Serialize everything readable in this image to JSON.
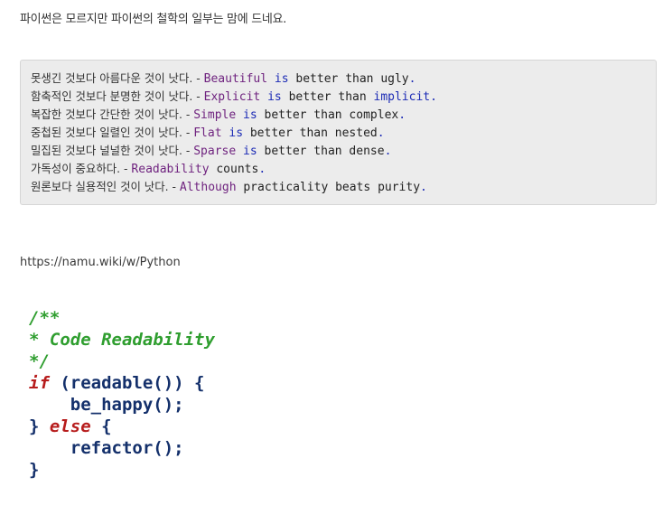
{
  "intro": {
    "text": "파이썬은 모르지만 파이썬의 철학의 일부는 맘에 드네요."
  },
  "philosophy": [
    {
      "ko": "못생긴 것보다 아름다운 것이 낫다. - ",
      "p1": "Beautiful",
      "p2": " is ",
      "p3": "better than ugly",
      "p4": "."
    },
    {
      "ko": "함축적인 것보다 분명한 것이 낫다. - ",
      "p1": "Explicit",
      "p2": " is ",
      "p3": "better than ",
      "p4": "implicit."
    },
    {
      "ko": "복잡한 것보다 간단한 것이 낫다. - ",
      "p1": "Simple",
      "p2": " is ",
      "p3": "better than complex",
      "p4": "."
    },
    {
      "ko": "중첩된 것보다 일렬인 것이 낫다. - ",
      "p1": "Flat",
      "p2": " is ",
      "p3": "better than nested",
      "p4": "."
    },
    {
      "ko": "밀집된 것보다 널널한 것이 낫다. - ",
      "p1": "Sparse",
      "p2": " is ",
      "p3": "better than dense",
      "p4": "."
    },
    {
      "ko": "가독성이 중요하다. - ",
      "p1": "Readability",
      "p2": " counts",
      "p3": "",
      "p4": "."
    },
    {
      "ko": "원론보다 실용적인 것이 낫다. - ",
      "p1": "Although",
      "p2": " practicality beats purity",
      "p3": "",
      "p4": "."
    }
  ],
  "link": {
    "text": "https://namu.wiki/w/Python"
  },
  "snippet": {
    "l1": "/**",
    "l2": "* Code Readability",
    "l3": "*/",
    "l4_kw": "if",
    "l4_rest": " (readable()) {",
    "l5": "    be_happy();",
    "l6_open": "} ",
    "l6_kw": "else",
    "l6_close": " {",
    "l7": "    refactor();",
    "l8": "}"
  },
  "colors": {
    "keyword_purple": "#6f237f",
    "keyword_navy": "#1c2bb5",
    "comment_green": "#2f9e2f",
    "keyword_red": "#b71c1c",
    "code_navy": "#14306b",
    "codebox_bg": "#ececec"
  }
}
